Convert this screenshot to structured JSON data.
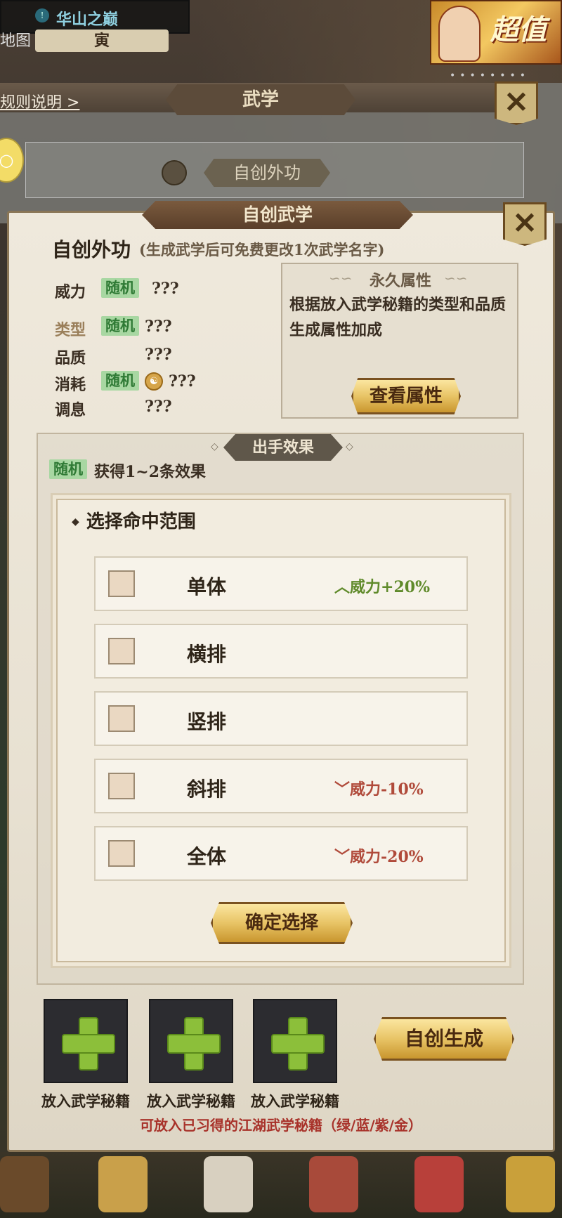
{
  "background": {
    "location": "华山之巅",
    "time": "寅",
    "map_label": "地图",
    "promo_text": "超值",
    "back_panel_title": "武学",
    "rules_link": "规则说明 >",
    "back_sub_title": "自创外功"
  },
  "panel": {
    "title": "自创武学",
    "skill_name": "自创外功",
    "skill_note": "(生成武学后可免费更改1次武学名字)",
    "attributes": [
      {
        "label": "威力",
        "tag": "随机",
        "value": "???"
      },
      {
        "label": "类型",
        "tag": "随机",
        "value": "???"
      },
      {
        "label": "品质",
        "tag": "",
        "value": "???"
      },
      {
        "label": "消耗",
        "tag": "随机",
        "value": "???"
      },
      {
        "label": "调息",
        "tag": "",
        "value": "???"
      }
    ],
    "permanent": {
      "title": "永久属性",
      "description": "根据放入武学秘籍的类型和品质生成属性加成",
      "view_button": "查看属性"
    },
    "effect": {
      "title": "出手效果",
      "tag": "随机",
      "description": "获得1~2条效果"
    },
    "range": {
      "title": "选择命中范围",
      "options": [
        {
          "label": "单体",
          "bonus": "威力+20%",
          "direction": "up",
          "checked": false
        },
        {
          "label": "横排",
          "bonus": "",
          "direction": "",
          "checked": false
        },
        {
          "label": "竖排",
          "bonus": "",
          "direction": "",
          "checked": false
        },
        {
          "label": "斜排",
          "bonus": "威力-10%",
          "direction": "down",
          "checked": false
        },
        {
          "label": "全体",
          "bonus": "威力-20%",
          "direction": "down",
          "checked": false
        }
      ],
      "confirm_button": "确定选择"
    },
    "slots": [
      {
        "label": "放入武学秘籍"
      },
      {
        "label": "放入武学秘籍"
      },
      {
        "label": "放入武学秘籍"
      }
    ],
    "generate_button": "自创生成",
    "hint": "可放入已习得的江湖武学秘籍（绿/蓝/紫/金）"
  },
  "colors": {
    "random_tag_bg": "#a8d7a2",
    "random_tag_text": "#2f7a35",
    "bonus_up": "#5f8a2a",
    "bonus_down": "#b04a3a",
    "hint": "#a8322a"
  }
}
